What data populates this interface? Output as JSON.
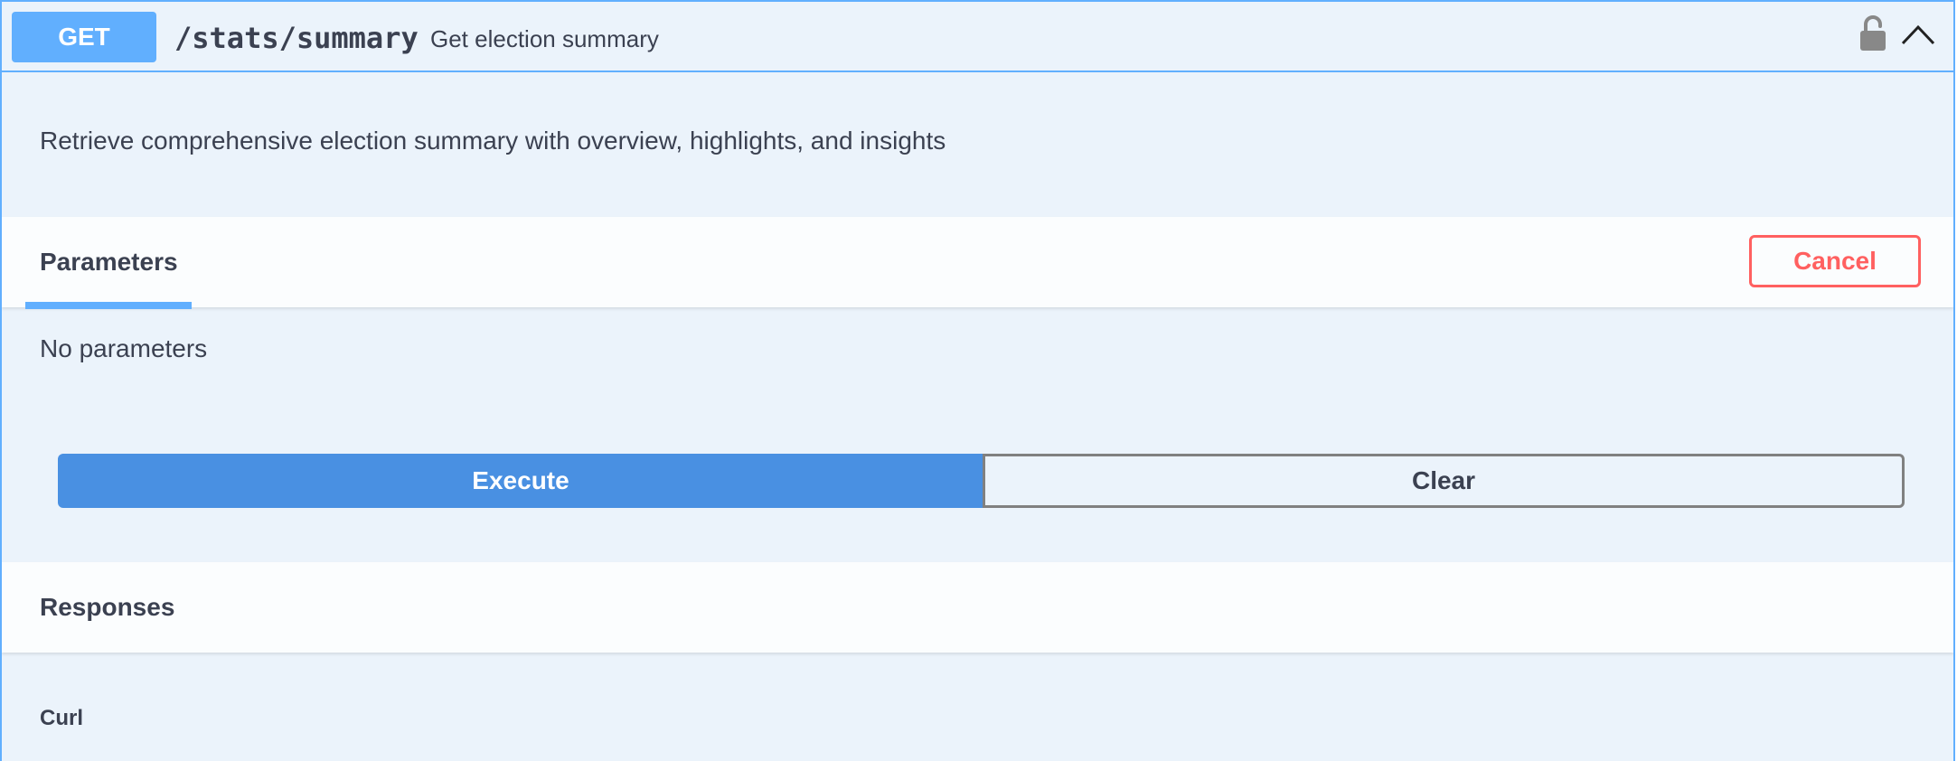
{
  "operation": {
    "method": "GET",
    "path": "/stats/summary",
    "summary": "Get election summary",
    "description": "Retrieve comprehensive election summary with overview, highlights, and insights",
    "lock_icon": "lock-icon",
    "collapse_icon": "chevron-up-icon"
  },
  "parameters": {
    "tab_label": "Parameters",
    "cancel_label": "Cancel",
    "empty_text": "No parameters"
  },
  "actions": {
    "execute_label": "Execute",
    "clear_label": "Clear"
  },
  "responses": {
    "title": "Responses",
    "curl_label": "Curl"
  },
  "colors": {
    "get_method": "#61affe",
    "execute": "#4990e2",
    "cancel": "#ff6060",
    "background": "#ebf3fb",
    "text": "#3b4151"
  }
}
